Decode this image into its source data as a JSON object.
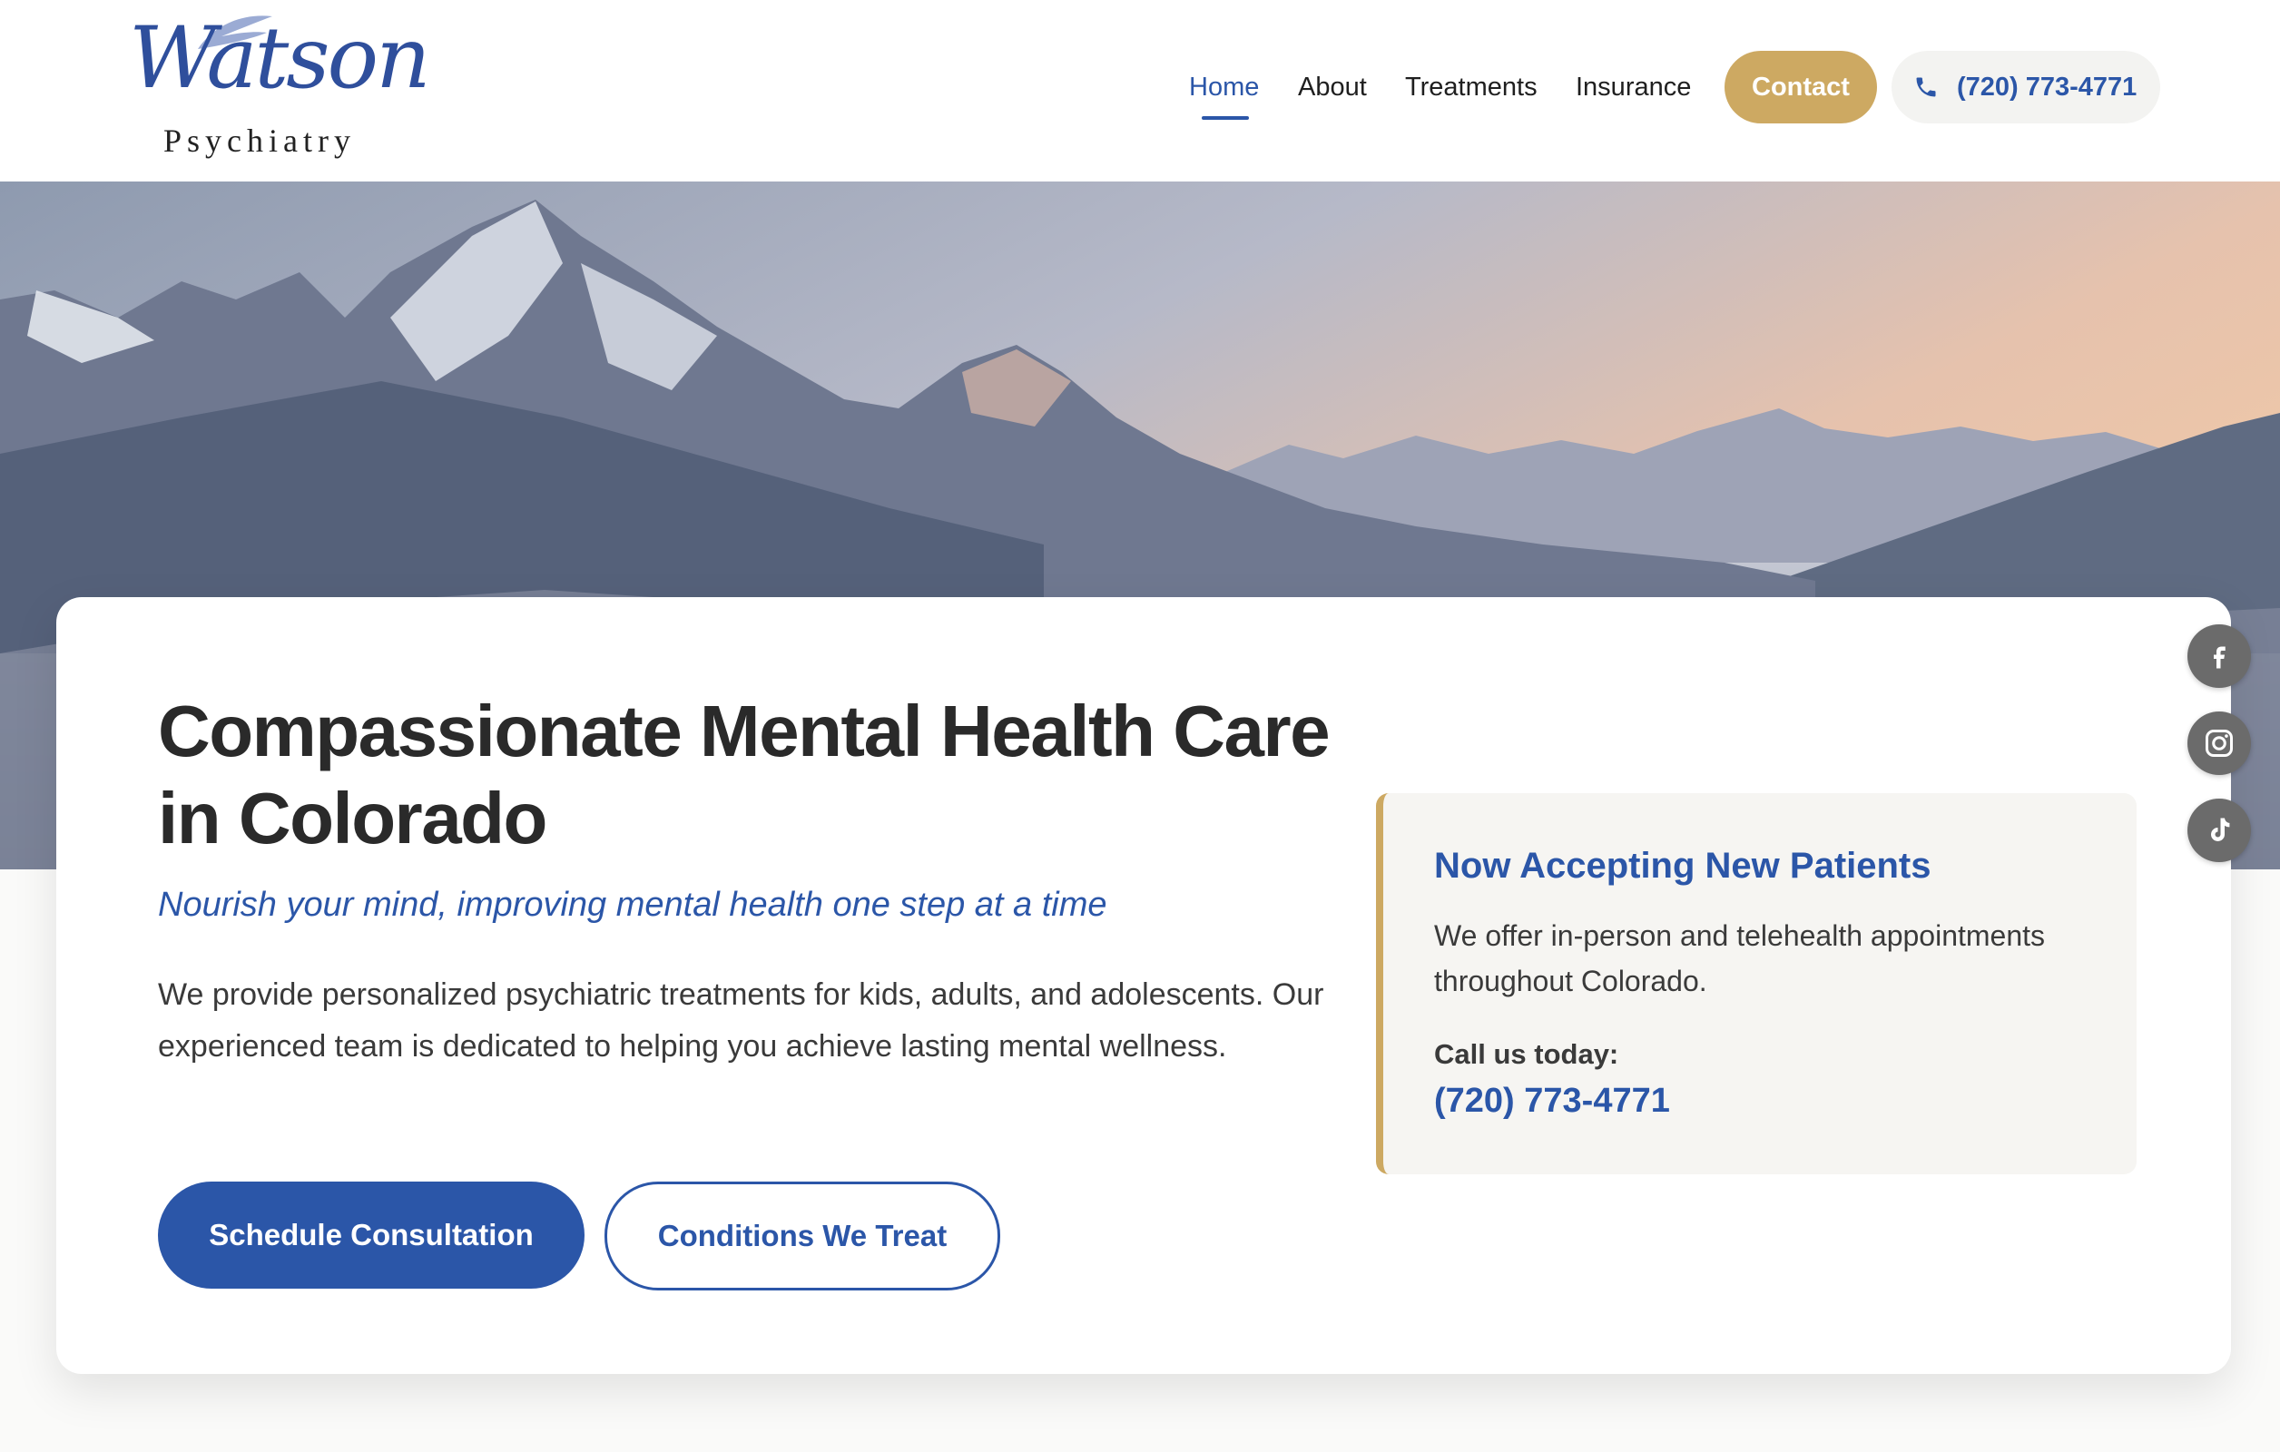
{
  "brand": {
    "logo_script": "Watson",
    "logo_sub": "Psychiatry"
  },
  "nav": {
    "items": [
      {
        "label": "Home",
        "active": true
      },
      {
        "label": "About",
        "active": false
      },
      {
        "label": "Treatments",
        "active": false
      },
      {
        "label": "Insurance",
        "active": false
      }
    ],
    "contact_label": "Contact",
    "phone_label": "(720) 773-4771"
  },
  "hero": {
    "headline": "Compassionate Mental Health Care in Colorado",
    "tagline": "Nourish your mind, improving mental health one step at a time",
    "body": "We provide personalized psychiatric treatments for kids, adults, and adolescents. Our experienced team is dedicated to helping you achieve lasting mental wellness.",
    "primary_cta": "Schedule Consultation",
    "secondary_cta": "Conditions We Treat"
  },
  "info_box": {
    "title": "Now Accepting New Patients",
    "text": "We offer in-person and telehealth appointments throughout Colorado.",
    "call_label": "Call us today:",
    "phone": "(720) 773-4771"
  },
  "social": {
    "icons": [
      "facebook-icon",
      "instagram-icon",
      "tiktok-icon"
    ]
  },
  "colors": {
    "primary": "#2b56a8",
    "accent_gold": "#cda962",
    "text": "#2a2a2a",
    "info_bg": "#f6f5f2"
  }
}
